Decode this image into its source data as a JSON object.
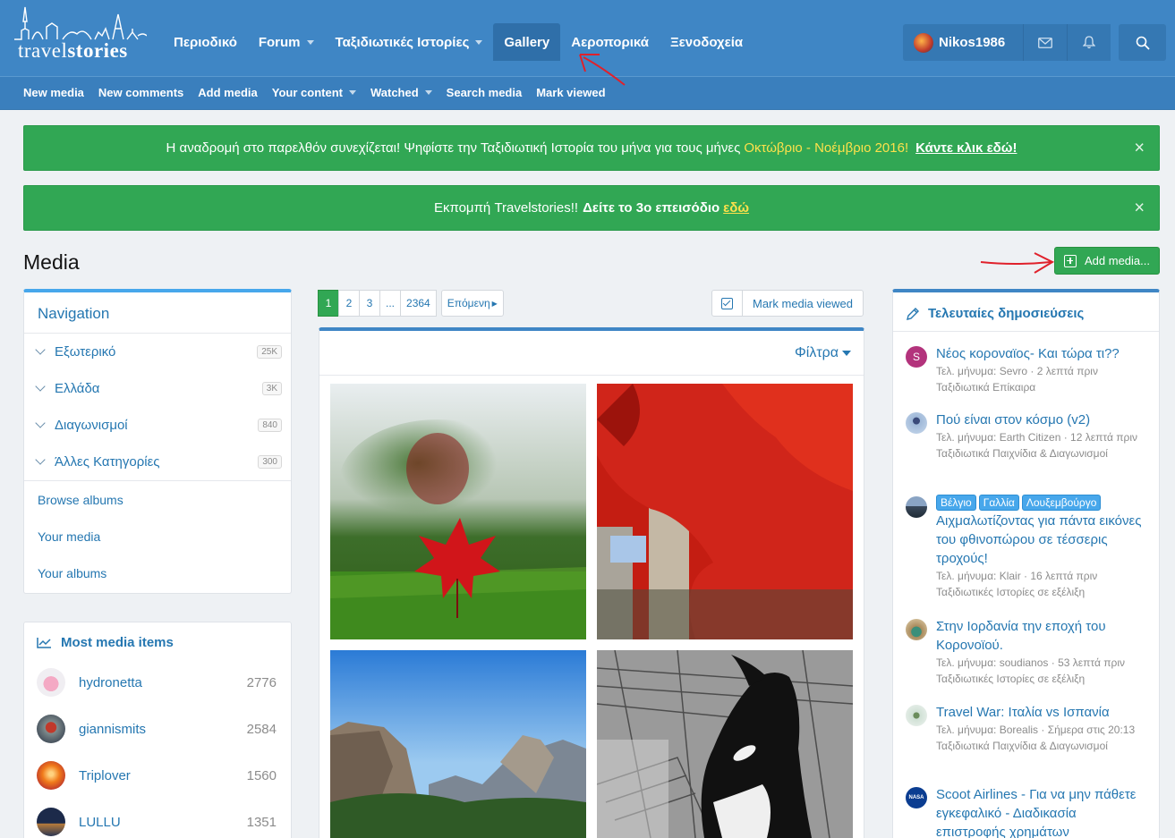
{
  "brand": {
    "logo_light": "travel",
    "logo_bold": "stories"
  },
  "nav": {
    "items": [
      {
        "label": "Περιοδικό",
        "caret": false
      },
      {
        "label": "Forum",
        "caret": true
      },
      {
        "label": "Ταξιδιωτικές Ιστορίες",
        "caret": true
      },
      {
        "label": "Gallery",
        "caret": false,
        "active": true
      },
      {
        "label": "Αεροπορικά",
        "caret": false
      },
      {
        "label": "Ξενοδοχεία",
        "caret": false
      }
    ],
    "user": "Nikos1986"
  },
  "subnav": {
    "items": [
      {
        "label": "New media",
        "caret": false
      },
      {
        "label": "New comments",
        "caret": false
      },
      {
        "label": "Add media",
        "caret": false
      },
      {
        "label": "Your content",
        "caret": true
      },
      {
        "label": "Watched",
        "caret": true
      },
      {
        "label": "Search media",
        "caret": false
      },
      {
        "label": "Mark viewed",
        "caret": false
      }
    ]
  },
  "notices": {
    "first": {
      "text": "Η αναδρομή στο παρελθόν συνεχίζεται! Ψηφίστε την Ταξιδιωτική Ιστορία του μήνα για τους μήνες",
      "highlight": "Οκτώβριο - Νοέμβριο 2016!",
      "link": "Κάντε κλικ εδώ!"
    },
    "second": {
      "text": "Εκπομπή Travelstories!!",
      "bold": "Δείτε το 3ο επεισόδιο",
      "link": "εδώ"
    },
    "close": "×"
  },
  "page": {
    "title": "Media",
    "add_button": "Add media..."
  },
  "navigation": {
    "title": "Navigation",
    "categories": [
      {
        "label": "Εξωτερικό",
        "count": "25K"
      },
      {
        "label": "Ελλάδα",
        "count": "3K"
      },
      {
        "label": "Διαγωνισμοί",
        "count": "840"
      },
      {
        "label": "Άλλες Κατηγορίες",
        "count": "300"
      }
    ],
    "links": [
      "Browse albums",
      "Your media",
      "Your albums"
    ]
  },
  "most_media": {
    "title": "Most media items",
    "users": [
      {
        "name": "hydronetta",
        "count": "2776"
      },
      {
        "name": "giannismits",
        "count": "2584"
      },
      {
        "name": "Triplover",
        "count": "1560"
      },
      {
        "name": "LULLU",
        "count": "1351"
      }
    ]
  },
  "pagination": {
    "pages": [
      "1",
      "2",
      "3",
      "...",
      "2364"
    ],
    "next": "Επόμενη",
    "mark_viewed": "Mark media viewed"
  },
  "filters": {
    "label": "Φίλτρα"
  },
  "recent": {
    "title": "Τελευταίες δημοσιεύσεις",
    "posts": [
      {
        "title": "Νέος κοροναϊος- Και τώρα τι??",
        "meta": "Τελ. μήνυμα: Sevro · 2 λεπτά πριν",
        "forum": "Ταξιδιωτικά Επίκαιρα",
        "avatar_letter": "S"
      },
      {
        "title": "Πού είναι στον κόσμο (v2)",
        "meta": "Τελ. μήνυμα: Earth Citizen · 12 λεπτά πριν",
        "forum": "Ταξιδιωτικά Παιχνίδια & Διαγωνισμοί"
      },
      {
        "tags": [
          "Βέλγιο",
          "Γαλλία",
          "Λουξεμβούργο"
        ],
        "title": "Αιχμαλωτίζοντας για πάντα εικόνες του φθινοπώρου σε τέσσερις τροχούς!",
        "meta": "Τελ. μήνυμα: Klair · 16 λεπτά πριν",
        "forum": "Ταξιδιωτικές Ιστορίες σε εξέλιξη"
      },
      {
        "title": "Στην Ιορδανία την εποχή του Κορονοϊού.",
        "meta": "Τελ. μήνυμα: soudianos · 53 λεπτά πριν",
        "forum": "Ταξιδιωτικές Ιστορίες σε εξέλιξη"
      },
      {
        "title": "Travel War: Ιταλία vs Ισπανία",
        "meta": "Τελ. μήνυμα: Borealis · Σήμερα στις 20:13",
        "forum": "Ταξιδιωτικά Παιχνίδια & Διαγωνισμοί"
      },
      {
        "title": "Scoot Airlines - Για να μην πάθετε εγκεφαλικό - Διαδικασία επιστροφής χρημάτων",
        "meta": "",
        "forum": "",
        "avatar_letter": "NASA"
      }
    ]
  },
  "colors": {
    "header": "#3f86c5",
    "accent": "#2577b1",
    "success": "#31a754",
    "highlight": "#fce14b",
    "annotation": "#e0212b"
  }
}
